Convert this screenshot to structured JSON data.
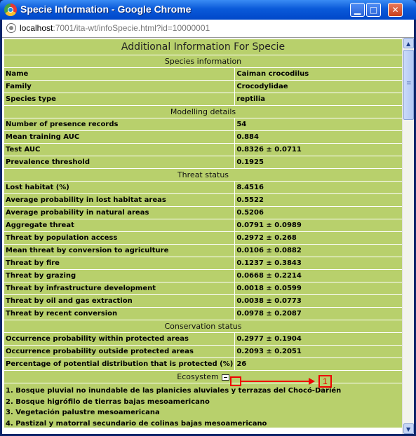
{
  "window": {
    "title": "Specie Information - Google Chrome",
    "minimize_glyph": "▁",
    "maximize_glyph": "□",
    "close_glyph": "✕"
  },
  "address": {
    "host": "localhost",
    "path": ":7001/ita-wt/infoSpecie.html?id=10000001"
  },
  "page": {
    "title": "Additional Information For Specie",
    "sections": {
      "species": "Species information",
      "modelling": "Modelling details",
      "threat": "Threat status",
      "conservation": "Conservation status",
      "ecosystem": "Ecosystem"
    },
    "species_rows": [
      {
        "label": "Name",
        "value": "Caiman crocodilus"
      },
      {
        "label": "Family",
        "value": "Crocodylidae"
      },
      {
        "label": "Species type",
        "value": "reptilia"
      }
    ],
    "modelling_rows": [
      {
        "label": "Number of presence records",
        "value": "54"
      },
      {
        "label": "Mean training AUC",
        "value": "0.884"
      },
      {
        "label": "Test AUC",
        "value": "0.8326 ± 0.0711"
      },
      {
        "label": "Prevalence threshold",
        "value": "0.1925"
      }
    ],
    "threat_rows": [
      {
        "label": "Lost habitat (%)",
        "value": "8.4516"
      },
      {
        "label": "Average probability in lost habitat areas",
        "value": "0.5522"
      },
      {
        "label": "Average probability in natural areas",
        "value": "0.5206"
      },
      {
        "label": "Aggregate threat",
        "value": "0.0791 ± 0.0989"
      },
      {
        "label": "Threat by population access",
        "value": "0.2972 ± 0.268"
      },
      {
        "label": "Mean threat by conversion to agriculture",
        "value": "0.0106 ± 0.0882"
      },
      {
        "label": "Threat by fire",
        "value": "0.1237 ± 0.3843"
      },
      {
        "label": "Threat by grazing",
        "value": "0.0668 ± 0.2214"
      },
      {
        "label": "Threat by infrastructure development",
        "value": "0.0018 ± 0.0599"
      },
      {
        "label": "Threat by oil and gas extraction",
        "value": "0.0038 ± 0.0773"
      },
      {
        "label": "Threat by recent conversion",
        "value": "0.0978 ± 0.2087"
      }
    ],
    "conservation_rows": [
      {
        "label": "Occurrence probability within protected areas",
        "value": "0.2977 ± 0.1904"
      },
      {
        "label": "Occurrence probability outside protected areas",
        "value": "0.2093 ± 0.2051"
      },
      {
        "label": "Percentage of potential distribution that is protected (%)",
        "value": "26"
      }
    ],
    "ecosystems": [
      "1. Bosque pluvial no inundable de las planicies aluviales y terrazas del Chocó-Darién",
      "2. Bosque higrófilo de tierras bajas mesoamericano",
      "3. Vegetación palustre mesoamericana",
      "4. Pastizal y matorral secundario de colinas bajas mesoamericano"
    ]
  },
  "annotation": {
    "callout_label": "1",
    "color": "#e00000"
  },
  "colors": {
    "row_bg": "#b8d06c",
    "title_bar": "#0a5ad9"
  }
}
